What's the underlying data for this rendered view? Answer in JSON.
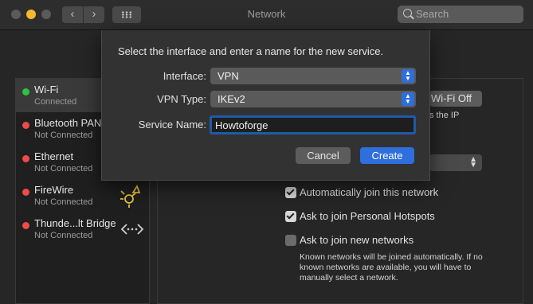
{
  "window": {
    "title": "Network"
  },
  "toolbar": {
    "back": "‹",
    "forward": "›",
    "grid_icon": "grid-icon",
    "search_placeholder": "Search"
  },
  "sidebar": {
    "items": [
      {
        "name": "Wi-Fi",
        "status": "Connected",
        "color": "#2ec43f",
        "icon": "wifi"
      },
      {
        "name": "Bluetooth PAN",
        "status": "Not Connected",
        "color": "#ef4a4a",
        "icon": "bluetooth"
      },
      {
        "name": "Ethernet",
        "status": "Not Connected",
        "color": "#ef4a4a",
        "icon": "ethernet"
      },
      {
        "name": "FireWire",
        "status": "Not Connected",
        "color": "#ef4a4a",
        "icon": "firewire-icon"
      },
      {
        "name": "Thunde...lt Bridge",
        "status": "Not Connected",
        "color": "#ef4a4a",
        "icon": "thunderbolt-bridge-icon"
      }
    ]
  },
  "panel": {
    "wifi_button": "Wi-Fi Off",
    "ip_text": "s the IP",
    "checkboxes": [
      {
        "label": "Automatically join this network",
        "checked": true
      },
      {
        "label": "Ask to join Personal Hotspots",
        "checked": true
      },
      {
        "label": "Ask to join new networks",
        "checked": false
      }
    ],
    "note": "Known networks will be joined automatically. If no known networks are available, you will have to manually select a network."
  },
  "dialog": {
    "title": "Select the interface and enter a name for the new service.",
    "interface_label": "Interface:",
    "interface_value": "VPN",
    "vpn_type_label": "VPN Type:",
    "vpn_type_value": "IKEv2",
    "service_name_label": "Service Name:",
    "service_name_value": "Howtoforge",
    "cancel": "Cancel",
    "create": "Create"
  },
  "colors": {
    "accent": "#2e6fdd",
    "connected": "#2ec43f",
    "disconnected": "#ef4a4a"
  }
}
